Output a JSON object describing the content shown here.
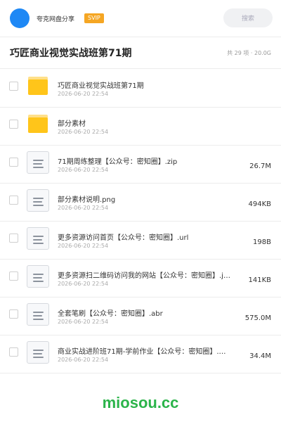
{
  "header": {
    "username": "夸克网盘分享",
    "badge": "SVIP",
    "search_placeholder": "搜索"
  },
  "title": {
    "text": "巧匠商业视觉实战班第71期",
    "meta": "共 29 项 · 20.0G"
  },
  "files": [
    {
      "name": "巧匠商业视觉实战班第71期",
      "date": "2026-06-20 22:54",
      "size": "",
      "type": "folder"
    },
    {
      "name": "部分素材",
      "date": "2026-06-20 22:54",
      "size": "",
      "type": "folder"
    },
    {
      "name": "71期周练整理【公众号：密知圈】.zip",
      "date": "2026-06-20 22:54",
      "size": "26.7M",
      "type": "doc"
    },
    {
      "name": "部分素材说明.png",
      "date": "2026-06-20 22:54",
      "size": "494KB",
      "type": "doc"
    },
    {
      "name": "更多资源访问首页【公众号：密知圈】.url",
      "date": "2026-06-20 22:54",
      "size": "198B",
      "type": "doc"
    },
    {
      "name": "更多资源扫二维码访问我的网站【公众号：密知圈】.j…",
      "date": "2026-06-20 22:54",
      "size": "141KB",
      "type": "doc"
    },
    {
      "name": "全套笔刷【公众号：密知圈】.abr",
      "date": "2026-06-20 22:54",
      "size": "575.0M",
      "type": "doc"
    },
    {
      "name": "商业实战进阶班71期-学前作业【公众号：密知圈】.…",
      "date": "2026-06-20 22:54",
      "size": "34.4M",
      "type": "doc"
    }
  ],
  "watermark": "miosou.cc",
  "colors": {
    "avatar": "#1e88f5",
    "svip_badge": "#f5a623",
    "folder": "#ffc51a",
    "watermark": "#2bb44a"
  }
}
